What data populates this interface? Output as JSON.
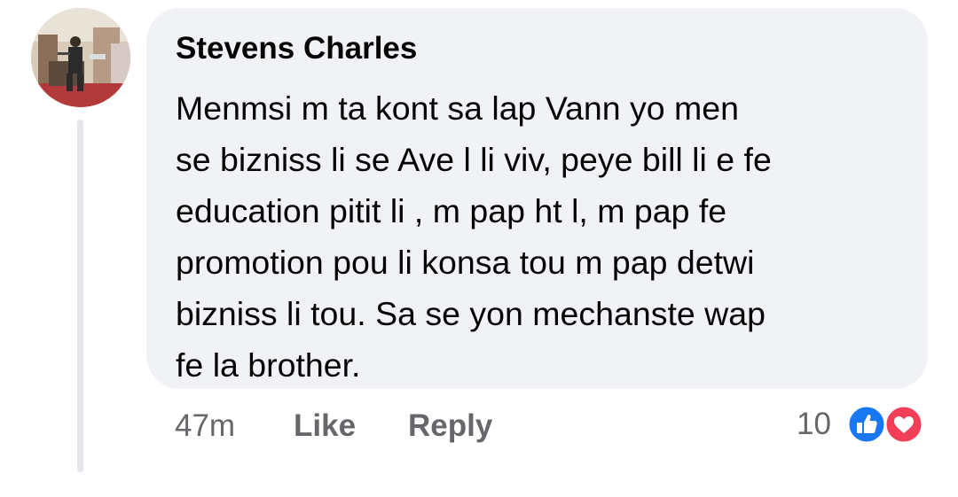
{
  "comment": {
    "author": "Stevens Charles",
    "text_lines": [
      "Menmsi m ta kont sa lap Vann yo men",
      "se bizniss li se Ave l li viv, peye bill li e fe",
      "education pitit li , m pap ht l, m pap fe",
      "promotion pou li konsa tou m pap detwi",
      "bizniss li tou. Sa se yon mechanste wap",
      "fe la brother."
    ],
    "timestamp": "47m",
    "actions": {
      "like_label": "Like",
      "reply_label": "Reply"
    },
    "reactions": {
      "count": "10",
      "icons": [
        "like-reaction-icon",
        "love-reaction-icon"
      ]
    }
  },
  "colors": {
    "bubble_bg": "#f0f2f5",
    "text": "#050505",
    "secondary_text": "#65676b",
    "like_blue": "#1877f2",
    "love_red": "#f33e58"
  }
}
